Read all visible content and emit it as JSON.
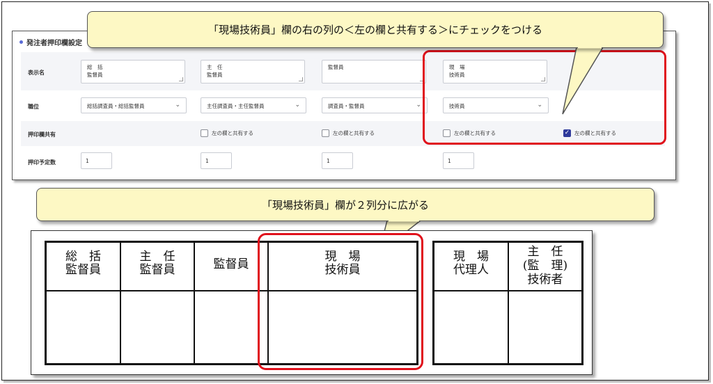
{
  "callout_top": "「現場技術員」欄の右の列の＜左の欄と共有する＞にチェックをつける",
  "callout_middle": "「現場技術員」欄が２列分に広がる",
  "form": {
    "section_title": "発注者押印欄設定",
    "labels": {
      "display_name": "表示名",
      "position": "職位",
      "shared": "押印欄共有",
      "count": "押印予定数"
    },
    "display_names": [
      "総　括\n監督員",
      "主　任\n監督員",
      "監督員",
      "現　場\n技術員"
    ],
    "positions": [
      "総括調査員・総括監督員",
      "主任調査員・主任監督員",
      "調査員・監督員",
      "技術員"
    ],
    "share_label": "左の欄と共有する",
    "share_checked": [
      false,
      false,
      false,
      true
    ],
    "counts": [
      "1",
      "1",
      "1",
      "1"
    ],
    "chevron": "⌄"
  },
  "stamp_table": {
    "group1": [
      "総　括\n監督員",
      "主　任\n監督員",
      "監督員",
      "現　場\n技術員"
    ],
    "group2": [
      "現　場\n代理人",
      "主　任\n(監　理)\n技術者"
    ]
  },
  "colors": {
    "highlight": "#e0101b",
    "callout_bg": "#fdf8c4",
    "checkbox": "#2f3a9b"
  }
}
